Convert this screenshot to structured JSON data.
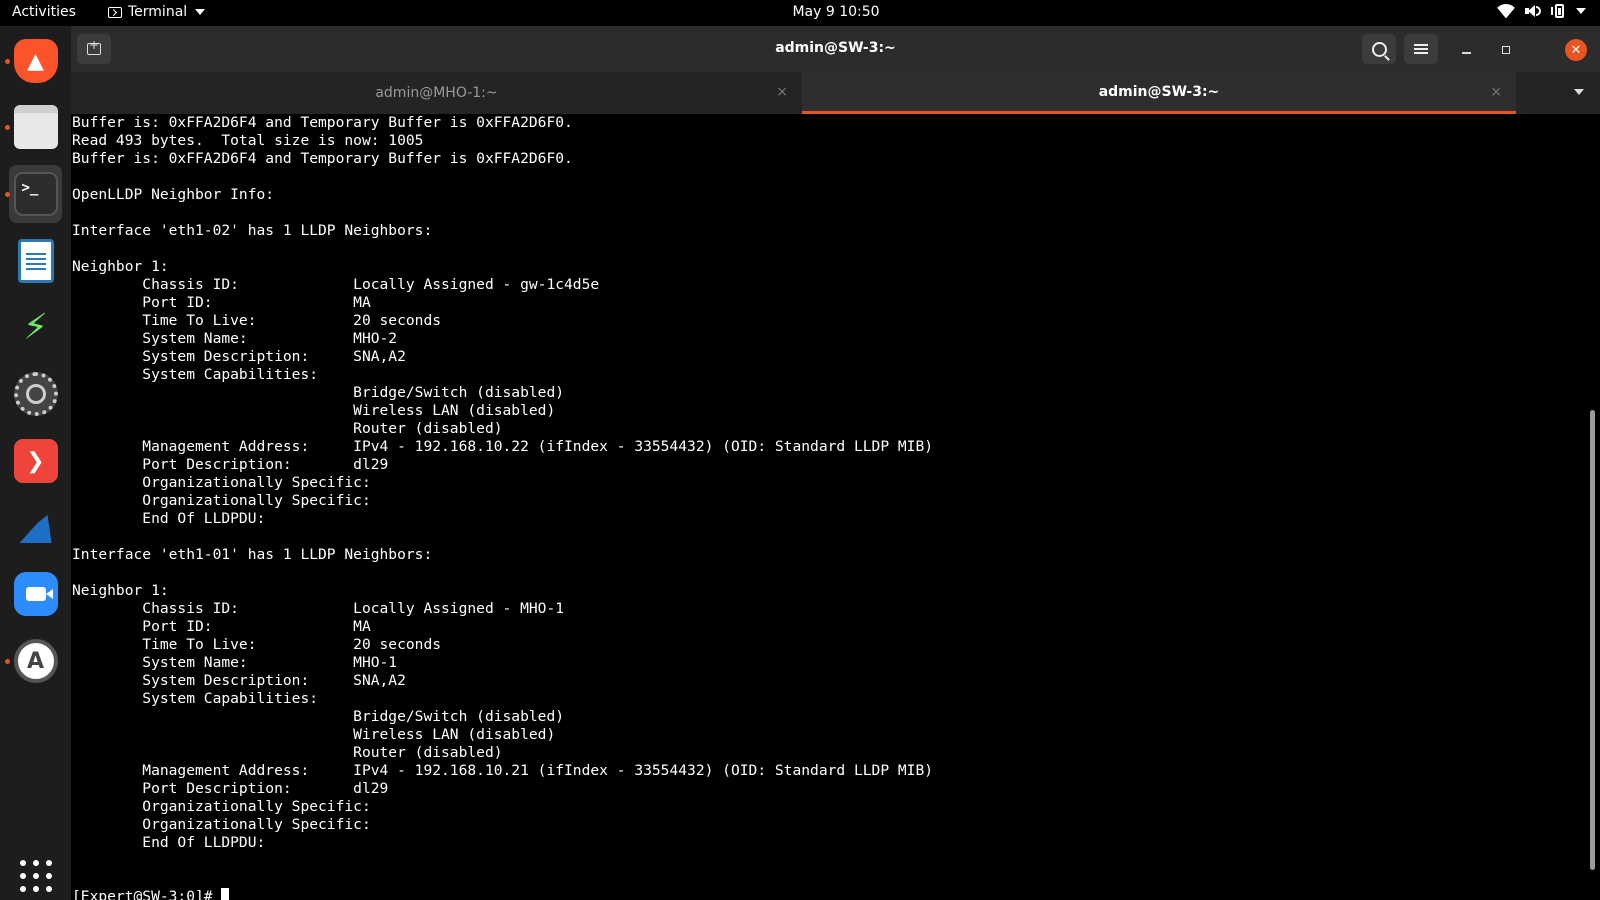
{
  "topbar": {
    "activities": "Activities",
    "app_name": "Terminal",
    "clock": "May 9  10:50",
    "icons": [
      "wifi-icon",
      "volume-icon",
      "battery-icon",
      "system-menu-chevron-icon"
    ]
  },
  "dock": {
    "apps": [
      "Brave Browser",
      "Files",
      "Terminal",
      "LibreOffice Writer",
      "Bolt App",
      "Settings",
      "AnyDesk",
      "Wireshark",
      "Zoom",
      "Ubuntu Software"
    ],
    "show_apps_icon": "grid-icon",
    "accent_color": "#e95420"
  },
  "window": {
    "title": "admin@SW-3:~",
    "new_tab_icon": "new-tab-icon",
    "search_icon": "search-icon",
    "menu_icon": "hamburger-icon",
    "close_color": "#e95420"
  },
  "tabs": [
    {
      "label": "admin@MHO-1:~",
      "close": "×"
    },
    {
      "label": "admin@SW-3:~",
      "close": "×"
    }
  ],
  "terminal": {
    "lines": [
      "Buffer is: 0xFFA2D6F4 and Temporary Buffer is 0xFFA2D6F0.",
      "Read 493 bytes.  Total size is now: 1005",
      "Buffer is: 0xFFA2D6F4 and Temporary Buffer is 0xFFA2D6F0.",
      "",
      "OpenLLDP Neighbor Info:",
      "",
      "Interface 'eth1-02' has 1 LLDP Neighbors:",
      "",
      "Neighbor 1:",
      "        Chassis ID:             Locally Assigned - gw-1c4d5e",
      "        Port ID:                MA",
      "        Time To Live:           20 seconds",
      "        System Name:            MHO-2",
      "        System Description:     SNA,A2",
      "        System Capabilities:",
      "                                Bridge/Switch (disabled)",
      "                                Wireless LAN (disabled)",
      "                                Router (disabled)",
      "        Management Address:     IPv4 - 192.168.10.22 (ifIndex - 33554432) (OID: Standard LLDP MIB)",
      "        Port Description:       dl29",
      "        Organizationally Specific:",
      "        Organizationally Specific:",
      "        End Of LLDPDU:",
      "",
      "Interface 'eth1-01' has 1 LLDP Neighbors:",
      "",
      "Neighbor 1:",
      "        Chassis ID:             Locally Assigned - MHO-1",
      "        Port ID:                MA",
      "        Time To Live:           20 seconds",
      "        System Name:            MHO-1",
      "        System Description:     SNA,A2",
      "        System Capabilities:",
      "                                Bridge/Switch (disabled)",
      "                                Wireless LAN (disabled)",
      "                                Router (disabled)",
      "        Management Address:     IPv4 - 192.168.10.21 (ifIndex - 33554432) (OID: Standard LLDP MIB)",
      "        Port Description:       dl29",
      "        Organizationally Specific:",
      "        Organizationally Specific:",
      "        End Of LLDPDU:",
      "",
      ""
    ],
    "prompt": "[Expert@SW-3:0]# "
  }
}
